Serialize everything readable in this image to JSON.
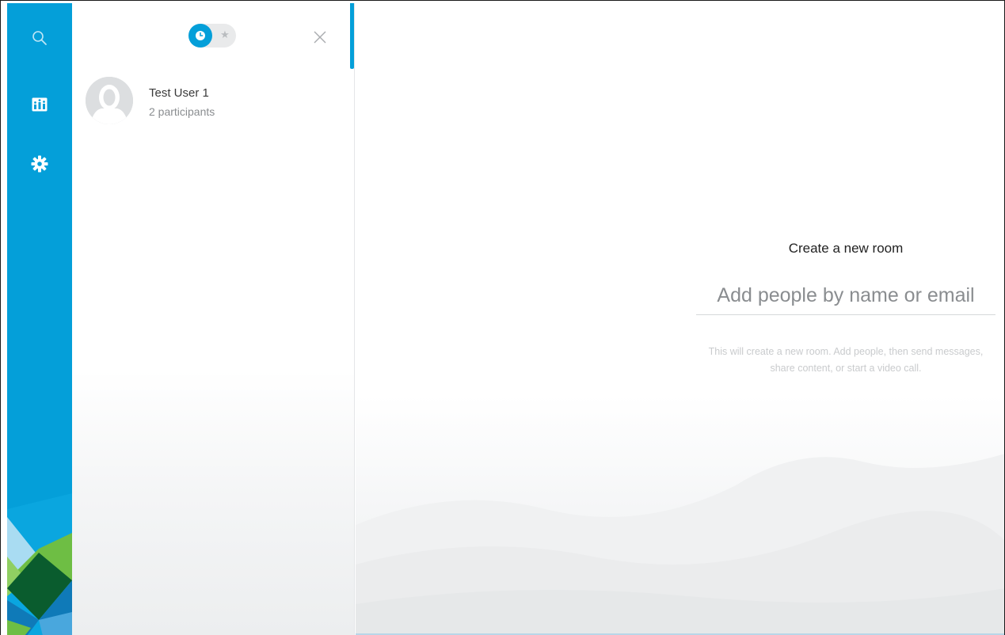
{
  "rail": {
    "items": [
      {
        "icon": "search-icon",
        "label": ""
      },
      {
        "icon": "team-icon",
        "label": ""
      },
      {
        "icon": "gear-icon",
        "label": ""
      }
    ],
    "colors": {
      "background": "#049fd9",
      "decor_dark": "#0a5c2e",
      "decor_green": "#6ebe44",
      "decor_blue": "#0f7ab8"
    }
  },
  "list_panel": {
    "toggle": {
      "active_icon": "clock-icon",
      "inactive_icon": "star-icon",
      "inactive_glyph": "★"
    },
    "close_icon": "close-icon",
    "rooms": [
      {
        "name": "Test User 1",
        "subtitle": "2 participants",
        "avatar_icon": "default-avatar-icon"
      }
    ]
  },
  "main": {
    "create_title": "Create a new room",
    "people_input": {
      "placeholder": "Add people by name or email",
      "value": ""
    },
    "help_text": "This will create a new room. Add people, then send messages, share content, or start a video call."
  },
  "colors": {
    "accent": "#049fd9",
    "muted_text": "#8a8d90",
    "help_text": "#c9cbcd"
  }
}
